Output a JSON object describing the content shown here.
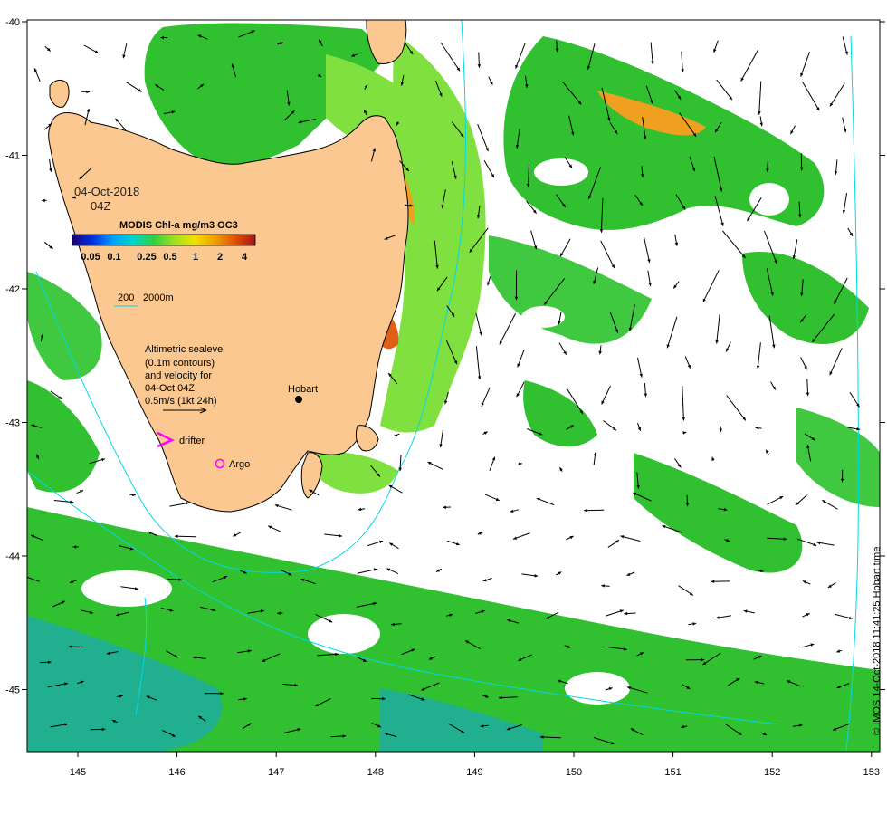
{
  "map": {
    "date_line1": "04-Oct-2018",
    "date_line2": "04Z",
    "colorbar_title": "MODIS Chl-a mg/m3 OC3",
    "colorbar_ticks": [
      "0.05",
      "0.1",
      "0.25",
      "0.5",
      "1",
      "2",
      "4"
    ],
    "colorbar_colors": [
      "#1a0080",
      "#0030e0",
      "#00a0ff",
      "#00d8c8",
      "#30d040",
      "#a0e020",
      "#f0e000",
      "#f0a000",
      "#e05000",
      "#a01818"
    ],
    "contour_legend_200": "200",
    "contour_legend_2000": "2000m",
    "velocity_legend": [
      "Altimetric sealevel",
      "(0.1m contours)",
      "and velocity for",
      "04-Oct 04Z",
      "0.5m/s (1kt 24h)"
    ],
    "drifter_label": "drifter",
    "argo_label": "Argo",
    "city_label": "Hobart",
    "credit": "© IMOS 14-Oct-2018 11:41:25 Hobart time",
    "x_ticks": [
      "145",
      "146",
      "147",
      "148",
      "149",
      "150",
      "151",
      "152",
      "153"
    ],
    "y_ticks": [
      "-40",
      "-41",
      "-42",
      "-43",
      "-44",
      "-45"
    ],
    "colors": {
      "land": "#fac890",
      "bathy": "#00d8e8",
      "drifter": "#ff00ff",
      "chl_green": "#30c030",
      "chl_light": "#80e040",
      "chl_teal": "#20b090",
      "chl_orange": "#f0a020"
    }
  }
}
